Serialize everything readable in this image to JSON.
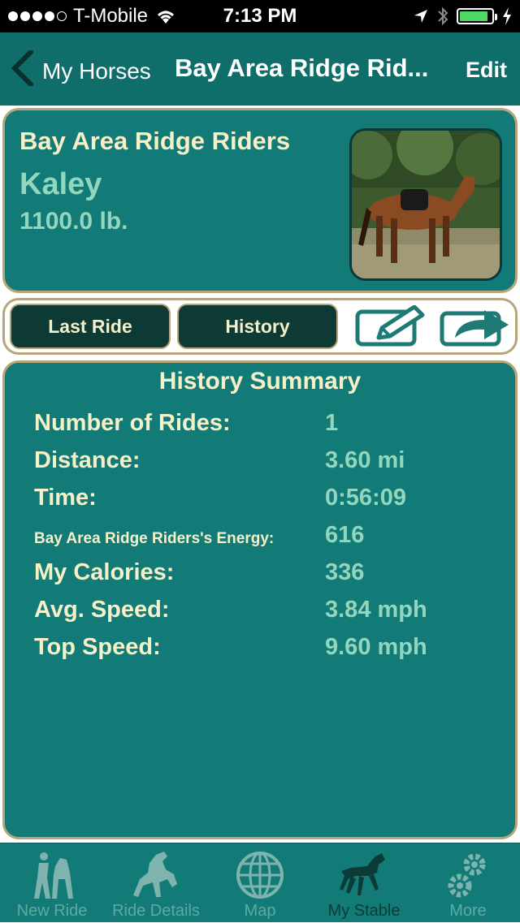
{
  "status_bar": {
    "carrier": "T-Mobile",
    "time": "7:13 PM",
    "signal_bars": 4,
    "signal_total": 5,
    "battery_fraction": 0.9,
    "icons": [
      "wifi-icon",
      "location-arrow-icon",
      "bluetooth-icon",
      "battery-icon",
      "charging-icon"
    ]
  },
  "nav": {
    "back_label": "My Horses",
    "title": "Bay Area Ridge Rid...",
    "edit_label": "Edit"
  },
  "horse": {
    "name": "Bay Area Ridge Riders",
    "rider": "Kaley",
    "weight": "1100.0 lb."
  },
  "segment_buttons": {
    "last_ride": "Last Ride",
    "history": "History"
  },
  "summary": {
    "title": "History Summary",
    "stats": [
      {
        "label": "Number of Rides:",
        "value": "1"
      },
      {
        "label": "Distance:",
        "value": "3.60 mi"
      },
      {
        "label": "Time:",
        "value": "0:56:09"
      },
      {
        "label": "Bay Area Ridge Riders's Energy:",
        "value": "616"
      },
      {
        "label": "My Calories:",
        "value": "336"
      },
      {
        "label": "Avg. Speed:",
        "value": "3.84 mph"
      },
      {
        "label": "Top Speed:",
        "value": "9.60 mph"
      }
    ]
  },
  "tabs": [
    {
      "label": "New Ride",
      "icon": "horse-rider-icon",
      "active": false
    },
    {
      "label": "Ride Details",
      "icon": "rearing-horse-icon",
      "active": false
    },
    {
      "label": "Map",
      "icon": "globe-icon",
      "active": false
    },
    {
      "label": "My Stable",
      "icon": "trotting-horse-icon",
      "active": true
    },
    {
      "label": "More",
      "icon": "gears-icon",
      "active": false
    }
  ],
  "colors": {
    "teal": "#137b77",
    "dark_teal": "#0d3a35",
    "gold_border": "#b8a67a",
    "cream_text": "#f6f0c8",
    "mint_text": "#92d6bd"
  }
}
